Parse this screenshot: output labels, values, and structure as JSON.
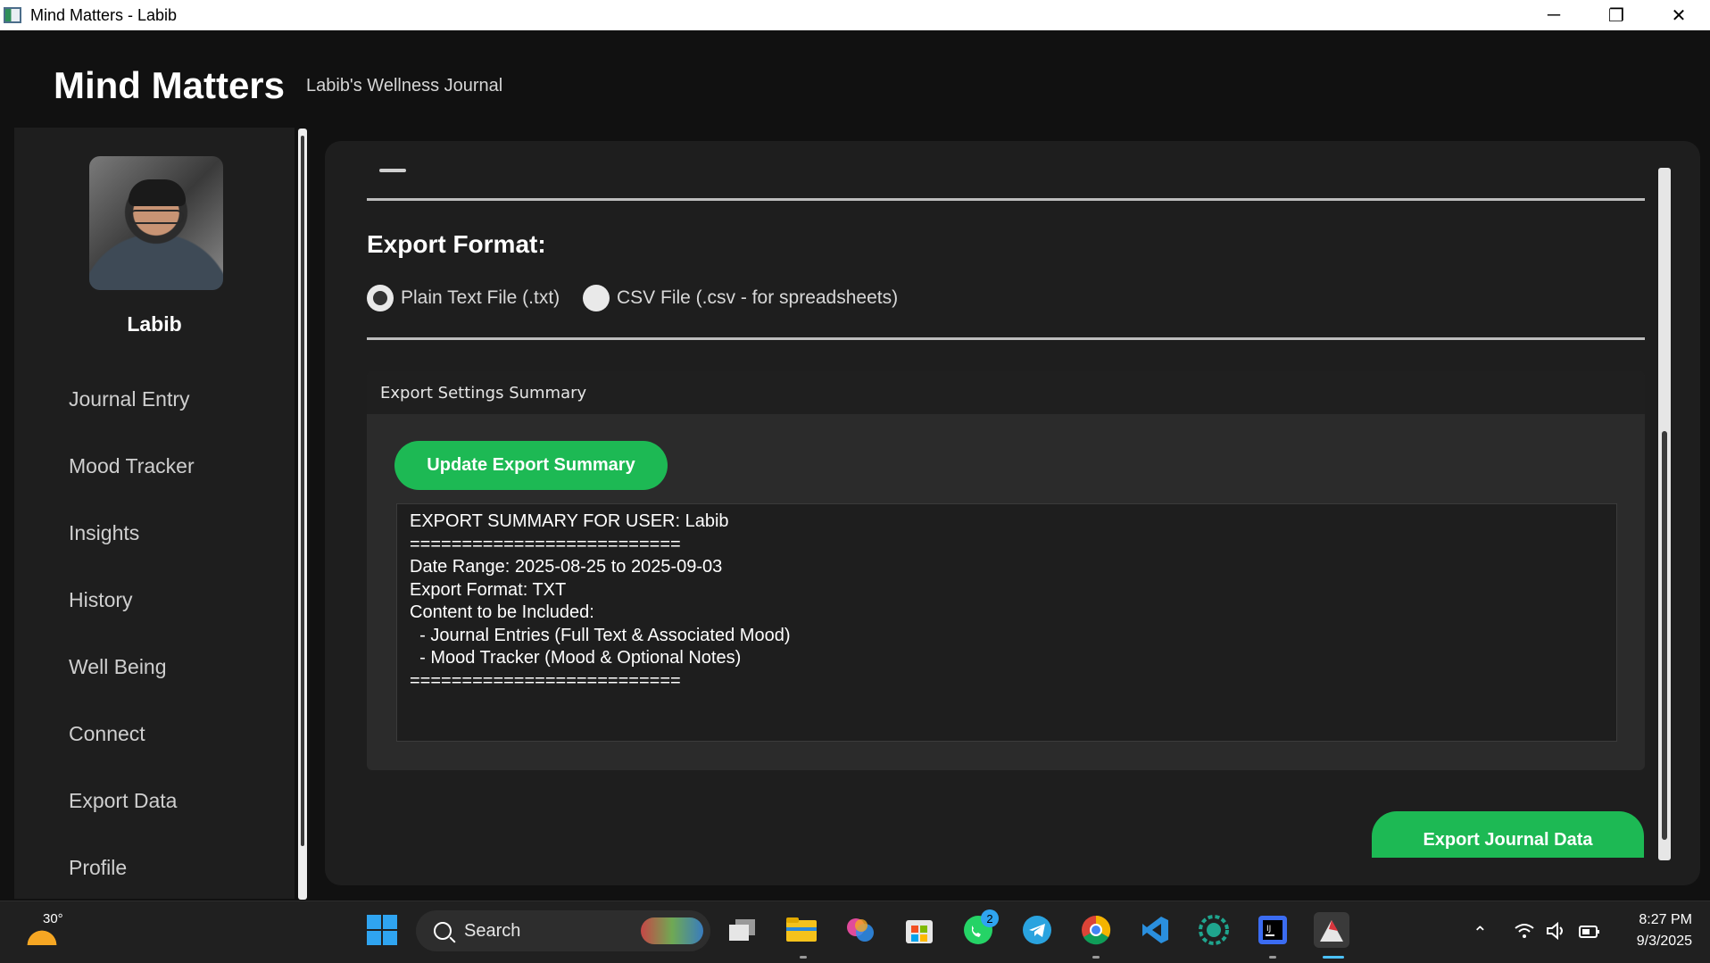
{
  "window": {
    "title": "Mind Matters - Labib",
    "minimize": "─",
    "restore": "❐",
    "close": "✕"
  },
  "header": {
    "title": "Mind Matters",
    "subtitle": "Labib's Wellness Journal"
  },
  "sidebar": {
    "user_name": "Labib",
    "items": [
      {
        "label": "Journal Entry"
      },
      {
        "label": "Mood Tracker"
      },
      {
        "label": "Insights"
      },
      {
        "label": "History"
      },
      {
        "label": "Well Being"
      },
      {
        "label": "Connect"
      },
      {
        "label": "Export Data"
      },
      {
        "label": "Profile"
      }
    ]
  },
  "main": {
    "export_format_title": "Export Format:",
    "format_options": [
      {
        "label": "Plain Text File (.txt)",
        "selected": true
      },
      {
        "label": "CSV File (.csv - for spreadsheets)",
        "selected": false
      }
    ],
    "summary_card_title": "Export Settings Summary",
    "update_button": "Update Export Summary",
    "summary_text": "EXPORT SUMMARY FOR USER: Labib\n==========================\nDate Range: 2025-08-25 to 2025-09-03\nExport Format: TXT\nContent to be Included:\n  - Journal Entries (Full Text & Associated Mood)\n  - Mood Tracker (Mood & Optional Notes)\n==========================",
    "export_button": "Export Journal Data"
  },
  "taskbar": {
    "weather_temp": "30°",
    "search_label": "Search",
    "whatsapp_badge": "2",
    "time": "8:27 PM",
    "date": "9/3/2025"
  },
  "colors": {
    "accent": "#1db954",
    "background": "#111111",
    "panel": "#1e1e1e"
  }
}
